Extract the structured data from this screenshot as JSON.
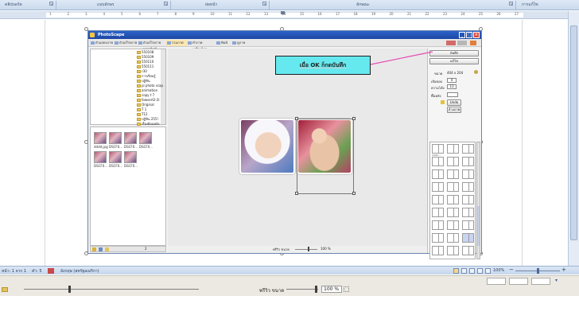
{
  "ribbon": {
    "groups": [
      "คลิปบอร์ด",
      "แบบอักษร",
      "ย่อหน้า",
      "ลักษณะ",
      "การแก้ไข"
    ]
  },
  "ruler": {
    "ticks": [
      "1",
      "2",
      "3",
      "4",
      "5",
      "6",
      "7",
      "8",
      "9",
      "10",
      "11",
      "12",
      "13",
      "14",
      "15",
      "16",
      "17",
      "18",
      "19",
      "20",
      "21",
      "22",
      "23",
      "24",
      "25",
      "26",
      "27"
    ]
  },
  "photoscape": {
    "title": "PhotoScape",
    "tabs": [
      "ตัวแสดงภาพ",
      "ตัวแก้ไขภาพ",
      "ตัวแก้ไขภาพหลายไฟล์",
      "รวมภาพ",
      "ทำภาพเคลื่อนไหว",
      "พิมพ์",
      "ดูภาพ"
    ],
    "folders": [
      "550108",
      "550109",
      "550110",
      "550111",
      "r30",
      "การเรียนรู้",
      "ปฏิทิน",
      "pi photo scap",
      "animation",
      "copy t 7",
      "fowsert2-2l",
      "Original",
      "T 1",
      "T12",
      "ปฏิทิน 255!",
      "เรื่องย้อนหลัง"
    ],
    "thumbnails": [
      "dddd.jpg",
      "DSCF0...",
      "DSCF0...",
      "DSCF0...",
      "DSCF0...",
      "DSCF0...",
      "DSCF0..."
    ],
    "zoom_label": "พรีวิว ขนาด",
    "zoom_value": "100 %",
    "left_zoom_value": "2",
    "right_panel": {
      "save_button": "บันทึก",
      "second_button": "แก้ไข",
      "size_label": "ขนาด",
      "size_value": "404 x 204",
      "margin_label": "เส้นขอบ",
      "margin_value": "4",
      "round_label": "ความโค้ง",
      "round_value": "13",
      "color_label": "พื้นหลัง",
      "button_a": "Undo",
      "button_b": "ล้างภาพ",
      "layout_label": "matri..."
    }
  },
  "callout": {
    "text": "เมื่อ OK  ก็กดบันทึก"
  },
  "statusbar": {
    "page": "หน้า: 1 จาก 1",
    "words": "คำ: 5",
    "language": "อังกฤษ (สหรัฐอเมริกา)",
    "zoom": "100%"
  },
  "lower": {
    "zoom_label": "พรีวิว ขนาด",
    "zoom_value": "100 %"
  },
  "colors": {
    "callout_bg": "#66e8ef",
    "arrow": "#e64ab1",
    "titlebar": "#1c47a3"
  }
}
